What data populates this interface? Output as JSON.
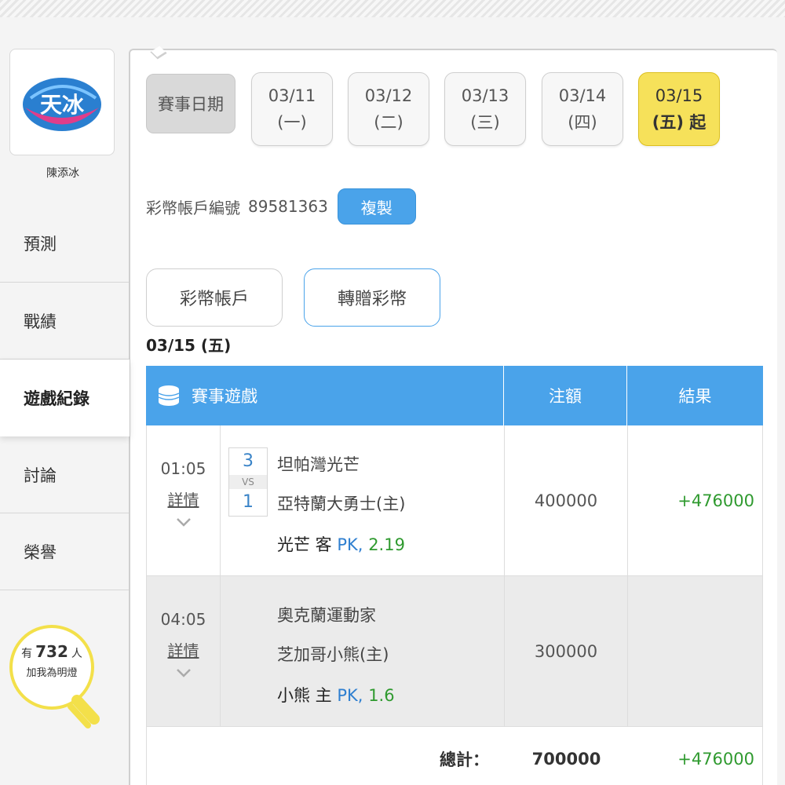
{
  "user": {
    "name": "陳添冰",
    "logo_text": "天冰"
  },
  "nav": [
    {
      "label": "預測"
    },
    {
      "label": "戰績"
    },
    {
      "label": "遊戲紀錄"
    },
    {
      "label": "討論"
    },
    {
      "label": "榮譽"
    }
  ],
  "fans": {
    "prefix": "有",
    "count": "732",
    "suffix": "人",
    "cta": "加我為明燈"
  },
  "dates": {
    "label": "賽事日期",
    "items": [
      {
        "date": "03/11",
        "dow": "(一)"
      },
      {
        "date": "03/12",
        "dow": "(二)"
      },
      {
        "date": "03/13",
        "dow": "(三)"
      },
      {
        "date": "03/14",
        "dow": "(四)"
      },
      {
        "date": "03/15",
        "dow": "(五) 起"
      }
    ]
  },
  "account": {
    "label": "彩幣帳戶編號",
    "number": "89581363",
    "copy": "複製"
  },
  "tabs": {
    "wallet": "彩幣帳戶",
    "gift": "轉贈彩幣"
  },
  "day_title": "03/15 (五)",
  "table": {
    "headers": {
      "game": "賽事遊戲",
      "stake": "注額",
      "result": "結果"
    },
    "rows": [
      {
        "time": "01:05",
        "detail": "詳情",
        "score_away": "3",
        "vs": "VS",
        "score_home": "1",
        "team_away": "坦帕灣光芒",
        "team_home": "亞特蘭大勇士(主)",
        "pick_team": "光芒 客",
        "pick_market": "PK,",
        "pick_odds": "2.19",
        "stake": "400000",
        "result": "+476000"
      },
      {
        "time": "04:05",
        "detail": "詳情",
        "team_away": "奧克蘭運動家",
        "team_home": "芝加哥小熊(主)",
        "pick_team": "小熊 主",
        "pick_market": "PK,",
        "pick_odds": "1.6",
        "stake": "300000",
        "result": ""
      }
    ],
    "total": {
      "label": "總計：",
      "stake": "700000",
      "result": "+476000"
    }
  },
  "colors": {
    "accent": "#4aa3ea",
    "active_date": "#f6e15a",
    "win": "#2f9a2f"
  }
}
